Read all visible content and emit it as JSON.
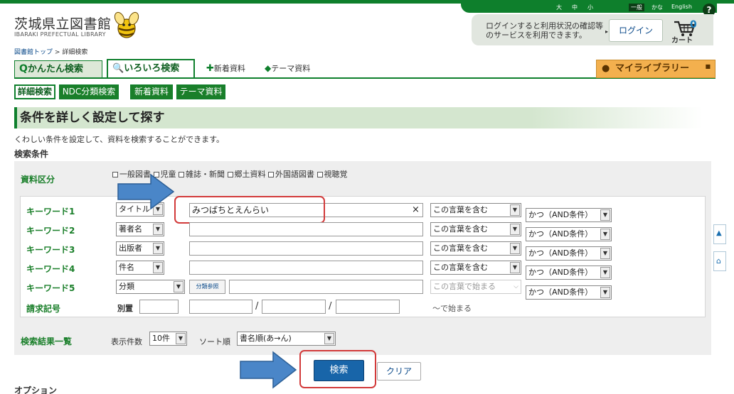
{
  "header": {
    "library_name": "茨城県立図書館",
    "library_name_en": "IBARAKI PREFECTUAL LIBRARY",
    "font_size_large": "大",
    "font_size_medium": "中",
    "font_size_small": "小",
    "lang_general": "一般",
    "lang_kana": "かな",
    "lang_english": "English",
    "help": "?",
    "login_note": "ログインすると利用状況の確認等のサービスを利用できます。",
    "login_button": "ログイン",
    "cart_count": "0",
    "cart_label": "カート"
  },
  "breadcrumb": {
    "home": "図書館トップ",
    "separator": ">",
    "current": "詳細検索"
  },
  "main_tabs": {
    "simple": "かんたん検索",
    "advanced": "いろいろ検索",
    "new": "新着資料",
    "theme": "テーマ資料",
    "mylibrary": "マイライブラリー"
  },
  "sub_tabs": [
    "詳細検索",
    "NDC分類検索",
    "新着資料",
    "テーマ資料"
  ],
  "page": {
    "heading": "条件を詳しく設定して探す",
    "description": "くわしい条件を設定して、資料を検索することができます。",
    "conditions_label": "検索条件",
    "options_label": "オプション"
  },
  "material_type": {
    "label": "資料区分",
    "options": [
      "一般図書",
      "児童",
      "雑誌・新聞",
      "郷土資料",
      "外国語図書",
      "視聴覚"
    ]
  },
  "keywords": [
    {
      "label": "キーワード1",
      "field": "タイトル",
      "value": "みつばちとえんらい",
      "clear": "×",
      "match": "この言葉を含む",
      "logic": "かつ（AND条件）"
    },
    {
      "label": "キーワード2",
      "field": "著者名",
      "value": "",
      "match": "この言葉を含む",
      "logic": "かつ（AND条件）"
    },
    {
      "label": "キーワード3",
      "field": "出版者",
      "value": "",
      "match": "この言葉を含む",
      "logic": "かつ（AND条件）"
    },
    {
      "label": "キーワード4",
      "field": "件名",
      "value": "",
      "match": "この言葉を含む",
      "logic": "かつ（AND条件）"
    },
    {
      "label": "キーワード5",
      "field": "分類",
      "ndc_button": "分類参照",
      "value": "",
      "match": "この言葉で始まる",
      "logic": "かつ（AND条件）"
    }
  ],
  "call_number": {
    "label": "請求記号",
    "sublabel": "別置",
    "slash": "/",
    "suffix": "〜で始まる"
  },
  "results": {
    "label": "検索結果一覧",
    "count_label": "表示件数",
    "count_value": "10件",
    "sort_label": "ソート順",
    "sort_value": "書名順(あ→ん)"
  },
  "actions": {
    "search": "検索",
    "clear": "クリア"
  },
  "colors": {
    "brand_green": "#0e7f2c",
    "search_blue": "#1865a9",
    "highlight_red": "#d23a3a",
    "arrow_blue": "#4a86c8",
    "mylib_orange": "#f3b04e"
  }
}
